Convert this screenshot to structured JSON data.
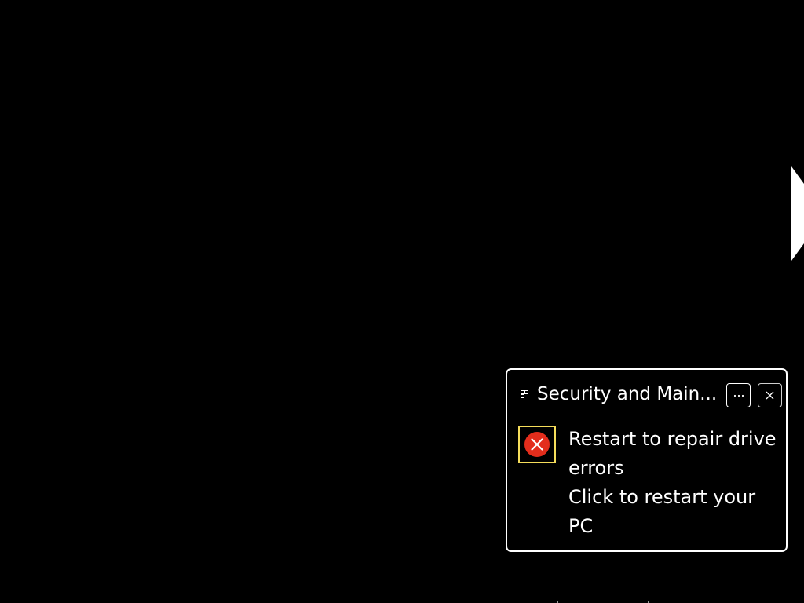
{
  "desktop": {
    "background_color": "#000000",
    "edge_arrow_icon": "chevron-right-icon"
  },
  "notification": {
    "app_name": "Security and Main...",
    "app_icon": "security-maintenance-icon",
    "more_button": {
      "label": "···",
      "icon": "ellipsis-icon"
    },
    "close_button": {
      "label": "×",
      "icon": "close-icon"
    },
    "status_icon": "error-circle-icon",
    "status_color": "#e81123",
    "focus_color": "#f5dd5b",
    "title": "Restart to repair drive errors",
    "message": "Click to restart your PC"
  }
}
